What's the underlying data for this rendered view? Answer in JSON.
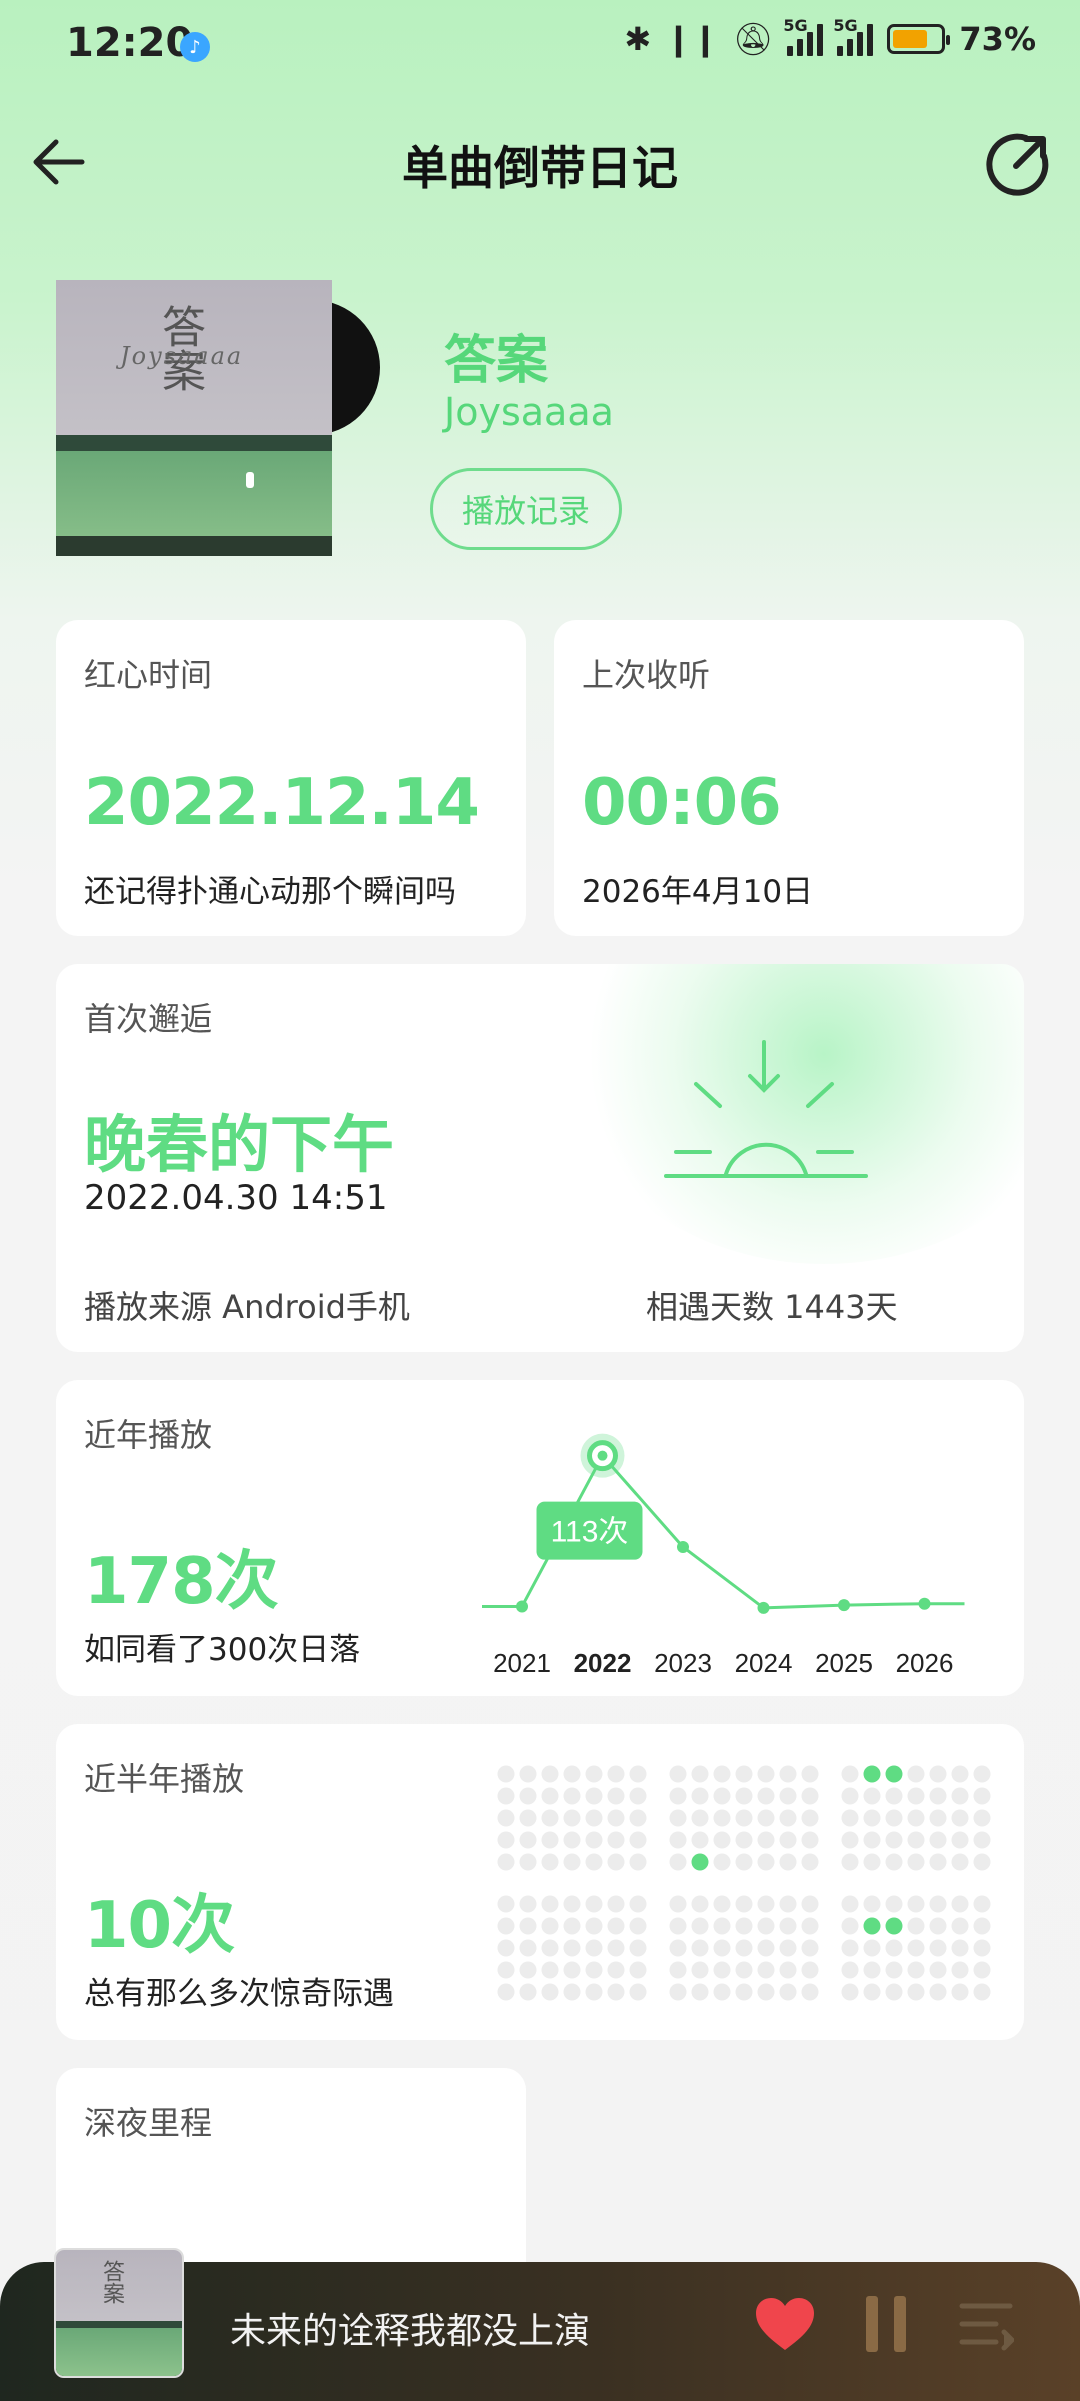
{
  "status_bar": {
    "time": "12:20",
    "net_label_1": "5G",
    "net_label_2": "5G",
    "battery_percent_text": "73%",
    "battery_level": 0.73
  },
  "header": {
    "title": "单曲倒带日记"
  },
  "song": {
    "title": "答案",
    "artist": "Joysaaaa",
    "history_button": "播放记录"
  },
  "cover_art": {
    "title": "答案",
    "subtitle": "Joysaaaa"
  },
  "heart_time": {
    "label": "红心时间",
    "value": "2022.12.14",
    "caption": "还记得扑通心动那个瞬间吗"
  },
  "last_listen": {
    "label": "上次收听",
    "value": "00:06",
    "caption": "2026年4月10日"
  },
  "first_encounter": {
    "label": "首次邂逅",
    "title": "晚春的下午",
    "datetime": "2022.04.30 14:51",
    "source": "播放来源 Android手机",
    "days": "相遇天数 1443天"
  },
  "recent_years": {
    "label": "近年播放",
    "value": "178次",
    "caption": "如同看了300次日落",
    "tooltip": "113次"
  },
  "half_year": {
    "label": "近半年播放",
    "value": "10次",
    "caption": "总有那么多次惊奇际遇"
  },
  "late_night": {
    "label": "深夜里程"
  },
  "player": {
    "lyric": "未来的诠释我都没上演"
  },
  "colors": {
    "accent": "#5fdc83",
    "dot_inactive": "#ececec",
    "player_bg": "#2b2b22",
    "heart": "#f0454c"
  },
  "chart_data": {
    "type": "line",
    "categories": [
      "2021",
      "2022",
      "2023",
      "2024",
      "2025",
      "2026"
    ],
    "values": [
      4,
      113,
      47,
      3,
      5,
      6
    ],
    "highlight_index": 1,
    "ylim": [
      0,
      120
    ]
  },
  "half_year_grid": {
    "groups": [
      {
        "rows": 5,
        "cols": 7,
        "active": []
      },
      {
        "rows": 5,
        "cols": 7,
        "active": [
          [
            4,
            1
          ]
        ]
      },
      {
        "rows": 5,
        "cols": 7,
        "active": [
          [
            0,
            1
          ],
          [
            0,
            2
          ]
        ]
      },
      {
        "rows": 5,
        "cols": 7,
        "active": []
      },
      {
        "rows": 5,
        "cols": 7,
        "active": []
      },
      {
        "rows": 5,
        "cols": 7,
        "active": [
          [
            1,
            1
          ],
          [
            1,
            2
          ]
        ]
      }
    ]
  }
}
